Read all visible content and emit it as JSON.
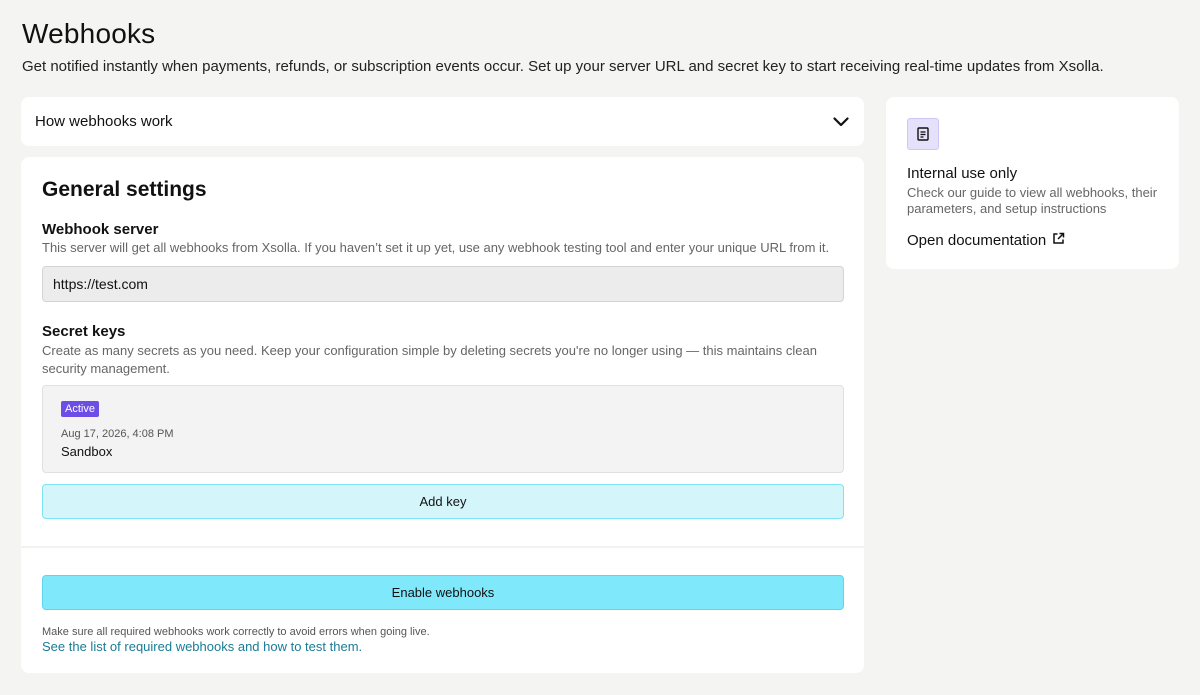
{
  "header": {
    "title": "Webhooks",
    "subtitle": "Get notified instantly when payments, refunds, or subscription events occur. Set up your server URL and secret key to start receiving real-time updates from Xsolla."
  },
  "accordion": {
    "title": "How webhooks work",
    "icon": "chevron-down-icon"
  },
  "settings": {
    "title": "General settings",
    "webhook_server": {
      "label": "Webhook server",
      "description": "This server will get all webhooks from Xsolla. If you haven’t set it up yet, use any webhook testing tool and enter your unique URL from it.",
      "url_value": "https://test.com"
    },
    "secret_keys": {
      "label": "Secret keys",
      "description": "Create as many secrets as you need. Keep your configuration simple by deleting secrets you're no longer using — this maintains clean security management.",
      "keys": [
        {
          "status": "Active",
          "date": "Aug 17, 2026, 4:08 PM",
          "name": "Sandbox"
        }
      ],
      "add_key_label": "Add key"
    },
    "enable_label": "Enable webhooks",
    "footer_note": "Make sure all required webhooks work correctly to avoid errors when going live.",
    "footer_link": "See the list of required webhooks and how to test them."
  },
  "sidebar": {
    "icon": "document-icon",
    "title": "Internal use only",
    "description": "Check our guide to view all webhooks, their parameters, and setup instructions",
    "link_label": "Open documentation",
    "link_icon": "external-link-icon"
  },
  "colors": {
    "background": "#f4f4f2",
    "badge": "#6c4de6",
    "add_key_bg": "#d4f6fb",
    "enable_bg": "#80e8fb",
    "link": "#1a7c95",
    "doc_icon_bg": "#e5e1fb"
  }
}
